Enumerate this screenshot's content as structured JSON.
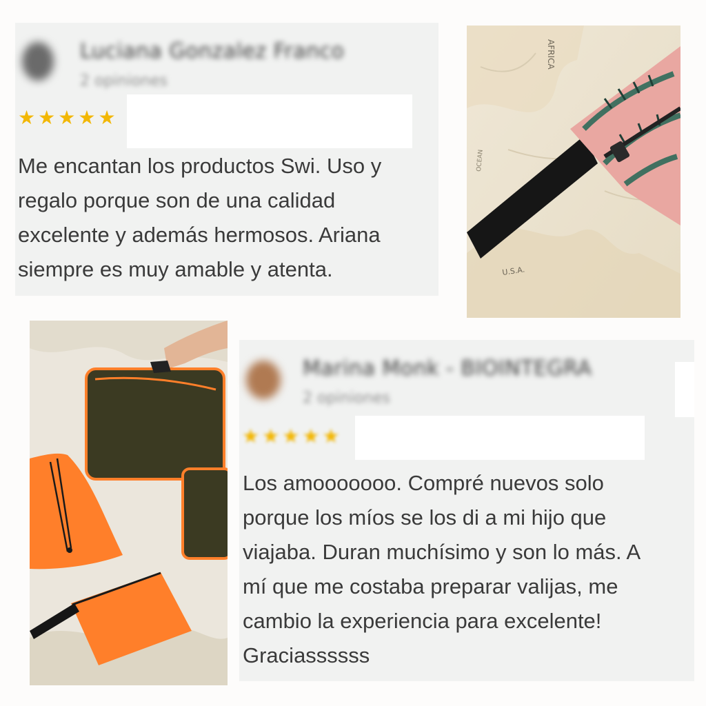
{
  "review_1": {
    "reviewer_name": "Luciana Gonzalez Franco",
    "reviewer_subtitle": "2 opiniones",
    "rating": 5,
    "text_lines": [
      "Me encantan los productos Swi. Uso y",
      "regalo porque son de una calidad",
      "excelente y además hermosos. Ariana",
      "siempre es muy amable y atenta."
    ]
  },
  "review_2": {
    "reviewer_name": "Marina Monk - BIOINTEGRA",
    "reviewer_subtitle": "2 opiniones",
    "rating": 5,
    "text_lines": [
      "Los amooooooo. Compré nuevos solo",
      "porque los míos se los di a mi hijo que",
      "viajaba. Duran muchísimo y son lo más. A",
      "mí que me costaba preparar valijas, me",
      "cambio la experiencia para excelente!",
      "Graciassssss"
    ]
  },
  "photos": {
    "top_right_map_labels": [
      "AFRICA",
      "OCEAN",
      "U.S.A."
    ],
    "bottom_left": "orange-and-olive-travel-organizers"
  },
  "colors": {
    "star": "#f2b705",
    "card_bg": "#f1f2f1",
    "bag_orange": "#ff7f2a",
    "bag_olive": "#3b3a22"
  }
}
